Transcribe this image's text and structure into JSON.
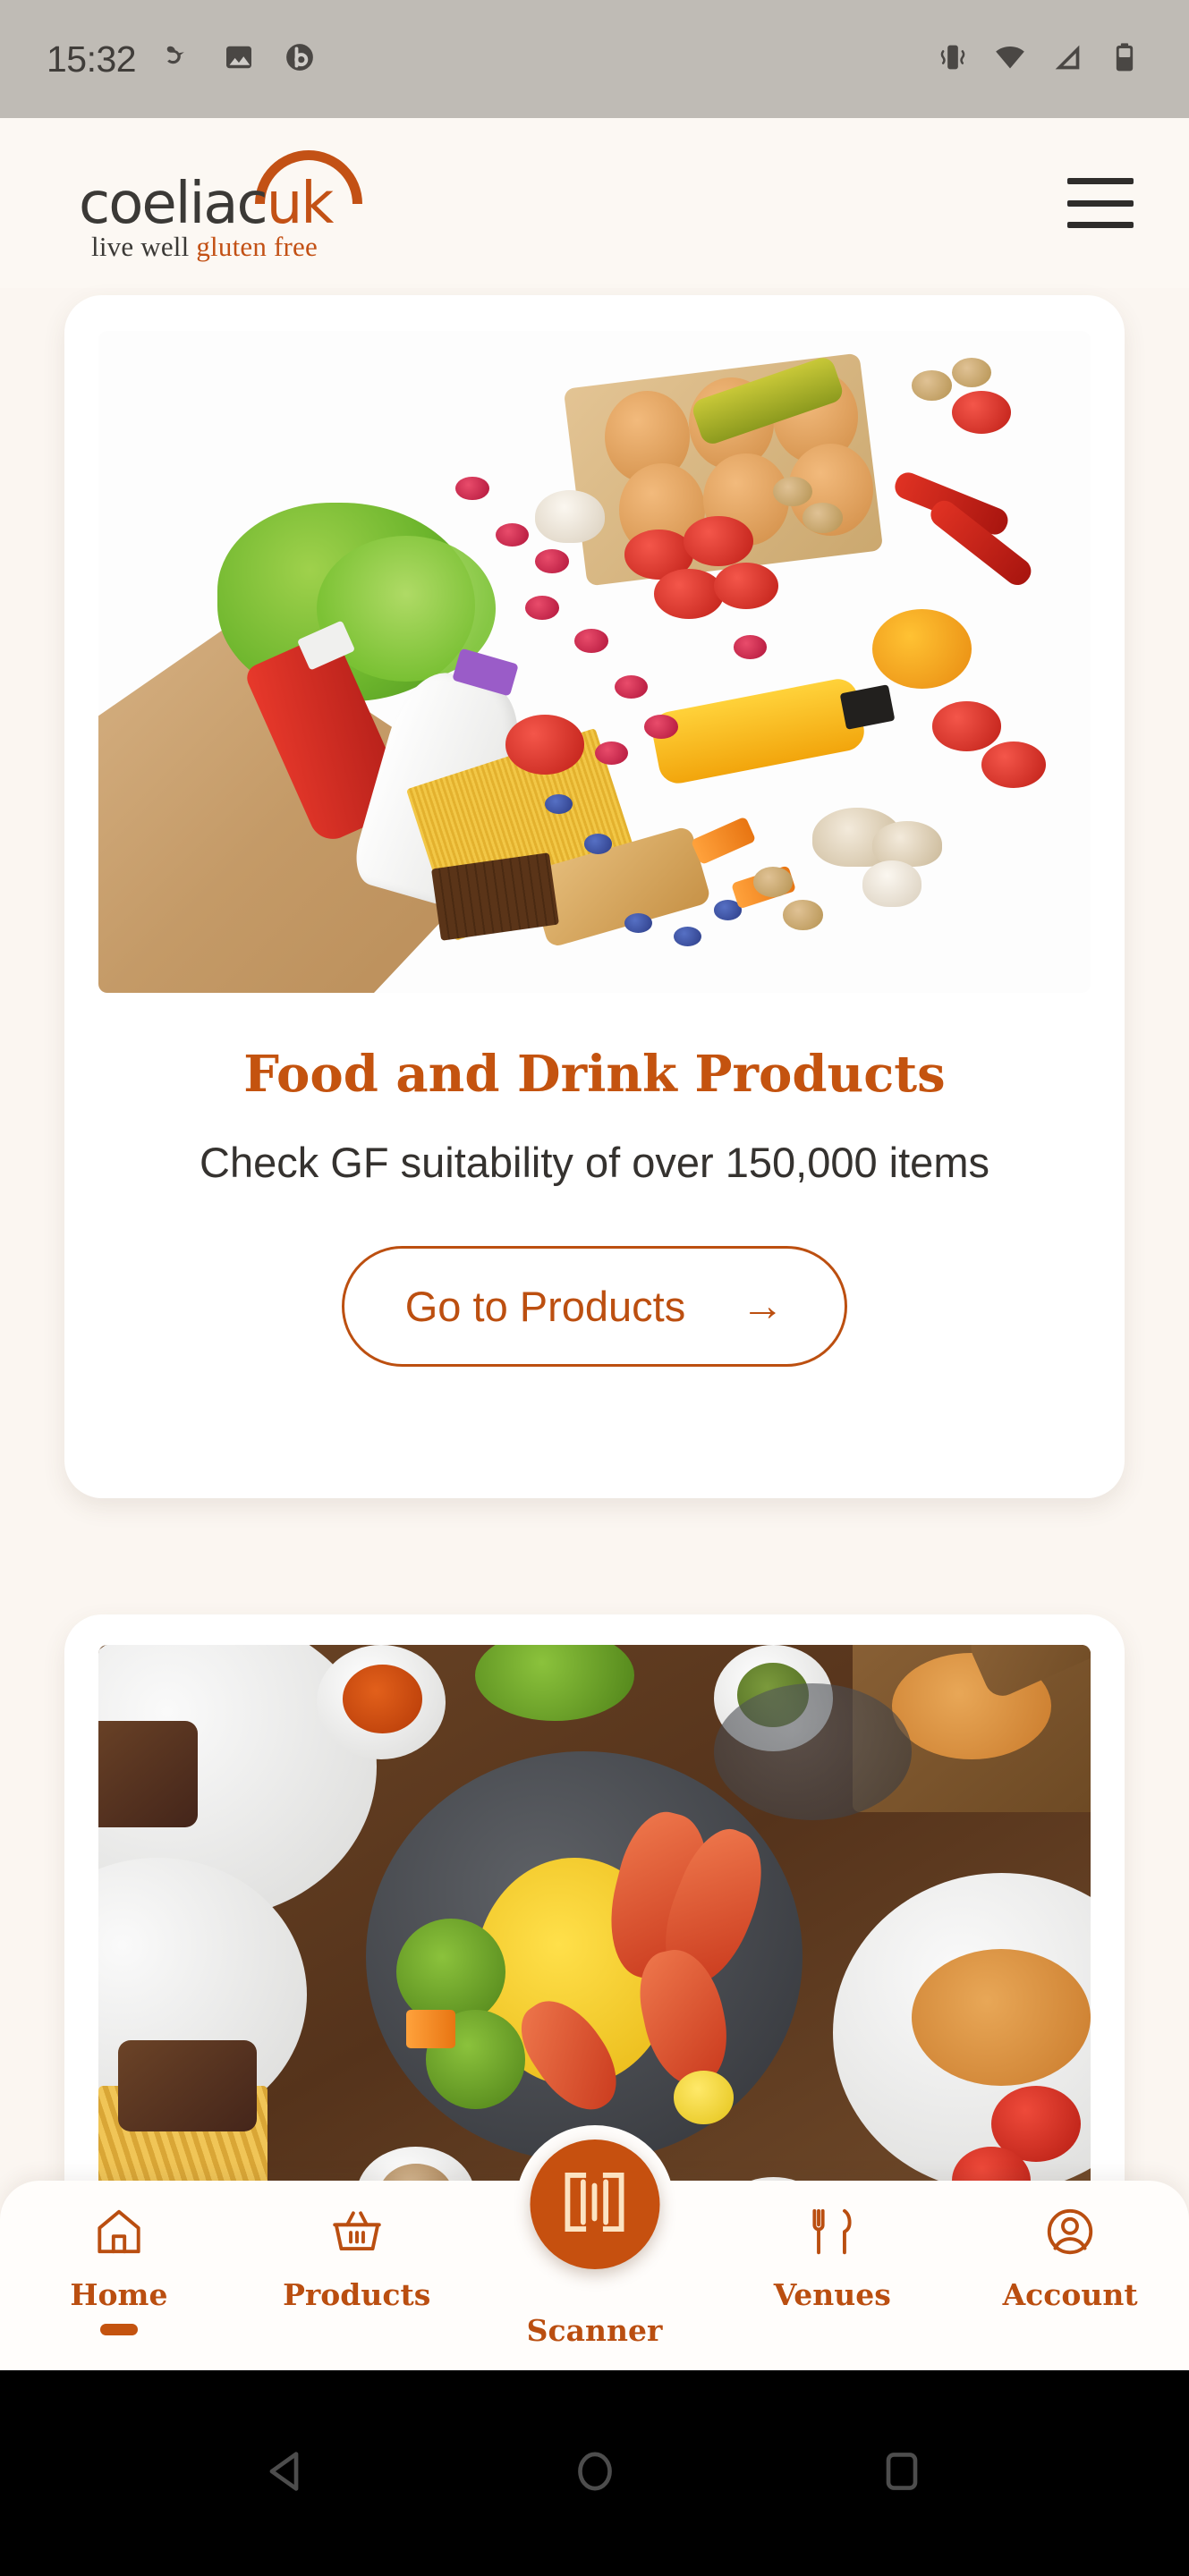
{
  "status_bar": {
    "time": "15:32",
    "left_icons": [
      "bird-app-icon",
      "gallery-icon",
      "beats-icon"
    ],
    "right_icons": [
      "vibrate-icon",
      "wifi-icon",
      "cellular-signal-icon",
      "battery-icon"
    ],
    "background_color": "#BFBBB5"
  },
  "header": {
    "logo": {
      "brand_part1": "coeliac",
      "brand_part2": "uk",
      "tagline_part1": "live well ",
      "tagline_part2": "gluten free"
    },
    "menu_icon": "hamburger-menu-icon",
    "background_color": "#FCF8F3"
  },
  "theme": {
    "accent": "#C4530F",
    "accent_dark": "#BA4E10",
    "page_background": "#FBF6F1",
    "card_background": "#FFFFFF",
    "text_dark": "#35322F"
  },
  "cards": [
    {
      "id": "products",
      "image_alt": "grocery-bag-with-fresh-food-photo",
      "title": "Food and Drink Products",
      "subtitle": "Check GF suitability of over 150,000 items",
      "cta_label": "Go to Products",
      "cta_arrow": "→"
    },
    {
      "id": "venues",
      "image_alt": "restaurant-table-with-dishes-photo"
    }
  ],
  "bottom_nav": {
    "items": [
      {
        "label": "Home",
        "icon": "house-icon",
        "active": true
      },
      {
        "label": "Products",
        "icon": "shopping-basket-icon",
        "active": false
      },
      {
        "label": "Scanner",
        "icon": "barcode-scanner-icon",
        "active": false
      },
      {
        "label": "Venues",
        "icon": "fork-and-knife-icon",
        "active": false
      },
      {
        "label": "Account",
        "icon": "user-circle-icon",
        "active": false
      }
    ]
  },
  "android_nav": {
    "buttons": [
      "back-button",
      "home-button",
      "recents-button"
    ],
    "background_color": "#000000"
  }
}
